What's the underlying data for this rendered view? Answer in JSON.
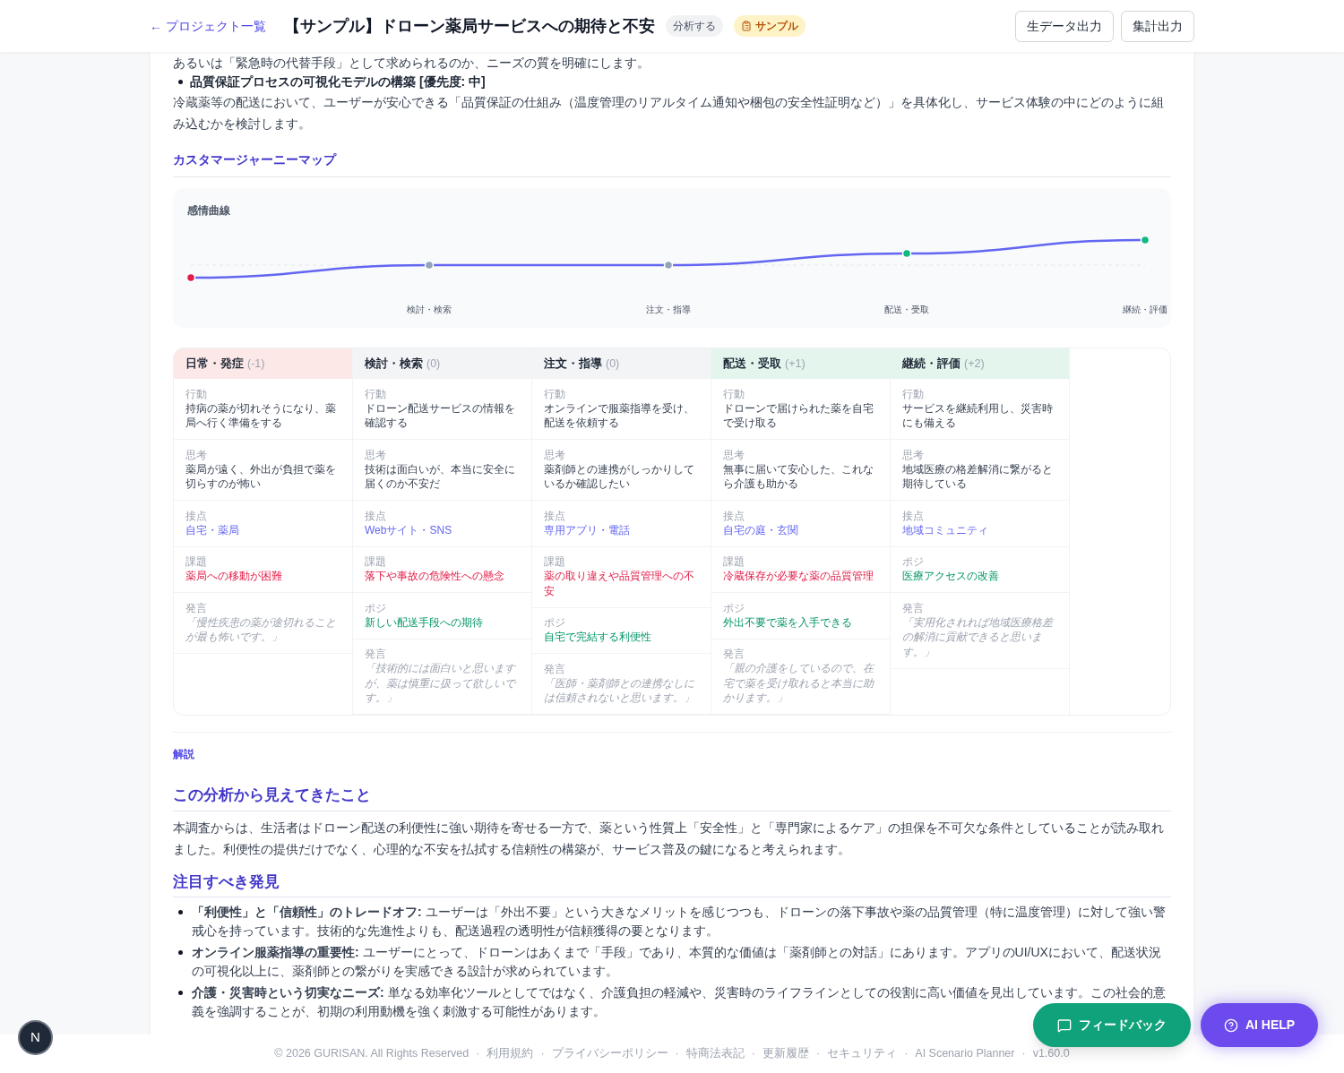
{
  "header": {
    "back_link": "← プロジェクト一覧",
    "title": "【サンプル】ドローン薬局サービスへの期待と不安",
    "badges": [
      {
        "kind": "status",
        "label": "分析する"
      },
      {
        "kind": "sample",
        "label": "サンプル"
      }
    ],
    "buttons": [
      "生データ出力",
      "集計出力"
    ]
  },
  "intro": {
    "partial_line": "あるいは「緊急時の代替手段」として求められるのか、ニーズの質を明確にします。",
    "bullet": "品質保証プロセスの可視化モデルの構築 [優先度: 中]",
    "paragraph": "冷蔵薬等の配送において、ユーザーが安心できる「品質保証の仕組み（温度管理のリアルタイム通知や梱包の安全性証明など）」を具体化し、サービス体験の中にどのように組み込むかを検討します。"
  },
  "journey_heading": "カスタマージャーニーマップ",
  "chart": {
    "title": "感情曲線",
    "labels": [
      "検討・検索",
      "注文・指導",
      "配送・受取",
      "継続・評価"
    ]
  },
  "stages": [
    {
      "name": "日常・発症",
      "score": "(-1)",
      "color": "#fde8e8",
      "cells": [
        {
          "kind": "action",
          "label": "行動",
          "text": "持病の薬が切れそうになり、薬局へ行く準備をする"
        },
        {
          "kind": "thought",
          "label": "思考",
          "text": "薬局が遠く、外出が負担で薬を切らすのが怖い"
        },
        {
          "kind": "touchpoint",
          "label": "接点",
          "text": "自宅・薬局"
        },
        {
          "kind": "issue",
          "label": "課題",
          "text": "薬局への移動が困難"
        },
        {
          "kind": "quote",
          "label": "発言",
          "text": "「慢性疾患の薬が途切れることが最も怖いです。」"
        }
      ]
    },
    {
      "name": "検討・検索",
      "score": "(0)",
      "color": "#f3f4f6",
      "cells": [
        {
          "kind": "action",
          "label": "行動",
          "text": "ドローン配送サービスの情報を確認する"
        },
        {
          "kind": "thought",
          "label": "思考",
          "text": "技術は面白いが、本当に安全に届くのか不安だ"
        },
        {
          "kind": "touchpoint",
          "label": "接点",
          "text": "Webサイト・SNS"
        },
        {
          "kind": "issue",
          "label": "課題",
          "text": "落下や事故の危険性への懸念"
        },
        {
          "kind": "positive",
          "label": "ポジ",
          "text": "新しい配送手段への期待"
        },
        {
          "kind": "quote",
          "label": "発言",
          "text": "「技術的には面白いと思いますが、薬は慎重に扱って欲しいです。」"
        }
      ]
    },
    {
      "name": "注文・指導",
      "score": "(0)",
      "color": "#f3f4f6",
      "cells": [
        {
          "kind": "action",
          "label": "行動",
          "text": "オンラインで服薬指導を受け、配送を依頼する"
        },
        {
          "kind": "thought",
          "label": "思考",
          "text": "薬剤師との連携がしっかりしているか確認したい"
        },
        {
          "kind": "touchpoint",
          "label": "接点",
          "text": "専用アプリ・電話"
        },
        {
          "kind": "issue",
          "label": "課題",
          "text": "薬の取り違えや品質管理への不安"
        },
        {
          "kind": "positive",
          "label": "ポジ",
          "text": "自宅で完結する利便性"
        },
        {
          "kind": "quote",
          "label": "発言",
          "text": "「医師・薬剤師との連携なしには信頼されないと思います。」"
        }
      ]
    },
    {
      "name": "配送・受取",
      "score": "(+1)",
      "color": "#e3f5ec",
      "cells": [
        {
          "kind": "action",
          "label": "行動",
          "text": "ドローンで届けられた薬を自宅で受け取る"
        },
        {
          "kind": "thought",
          "label": "思考",
          "text": "無事に届いて安心した、これなら介護も助かる"
        },
        {
          "kind": "touchpoint",
          "label": "接点",
          "text": "自宅の庭・玄関"
        },
        {
          "kind": "issue",
          "label": "課題",
          "text": "冷蔵保存が必要な薬の品質管理"
        },
        {
          "kind": "positive",
          "label": "ポジ",
          "text": "外出不要で薬を入手できる"
        },
        {
          "kind": "quote",
          "label": "発言",
          "text": "「親の介護をしているので、在宅で薬を受け取れると本当に助かります。」"
        }
      ]
    },
    {
      "name": "継続・評価",
      "score": "(+2)",
      "color": "#e3f5ec",
      "cells": [
        {
          "kind": "action",
          "label": "行動",
          "text": "サービスを継続利用し、災害時にも備える"
        },
        {
          "kind": "thought",
          "label": "思考",
          "text": "地域医療の格差解消に繋がると期待している"
        },
        {
          "kind": "touchpoint",
          "label": "接点",
          "text": "地域コミュニティ"
        },
        {
          "kind": "positive",
          "label": "ポジ",
          "text": "医療アクセスの改善"
        },
        {
          "kind": "quote",
          "label": "発言",
          "text": "「実用化されれば地域医療格差の解消に貢献できると思います。」"
        }
      ]
    }
  ],
  "commentary": {
    "label": "解説",
    "sections": [
      {
        "heading": "この分析から見えてきたこと",
        "paragraph": "本調査からは、生活者はドローン配送の利便性に強い期待を寄せる一方で、薬という性質上「安全性」と「専門家によるケア」の担保を不可欠な条件としていることが読み取れました。利便性の提供だけでなく、心理的な不安を払拭する信頼性の構築が、サービス普及の鍵になると考えられます。"
      },
      {
        "heading": "注目すべき発見",
        "bullets": [
          "**「利便性」と「信頼性」のトレードオフ:** ユーザーは「外出不要」という大きなメリットを感じつつも、ドローンの落下事故や薬の品質管理（特に温度管理）に対して強い警戒心を持っています。技術的な先進性よりも、配送過程の透明性が信頼獲得の要となります。",
          "**オンライン服薬指導の重要性:** ユーザーにとって、ドローンはあくまで「手段」であり、本質的な価値は「薬剤師との対話」にあります。アプリのUI/UXにおいて、配送状況の可視化以上に、薬剤師との繋がりを実感できる設計が求められています。",
          "**介護・災害時という切実なニーズ:** 単なる効率化ツールとしてではなく、介護負担の軽減や、災害時のライフラインとしての役割に高い価値を見出しています。この社会的意義を強調することが、初期の利用動機を強く刺激する可能性があります。"
        ]
      }
    ]
  },
  "footer": {
    "copyright": "© 2026 GURISAN. All Rights Reserved",
    "separator": "·",
    "links": [
      "利用規約",
      "プライバシーポリシー",
      "特商法表記",
      "更新履歴",
      "セキュリティ",
      "AI Scenario Planner"
    ],
    "version": "v1.60.0"
  },
  "floating": {
    "feedback": "フィードバック",
    "ai_help": "AI HELP",
    "avatar": "N"
  }
}
